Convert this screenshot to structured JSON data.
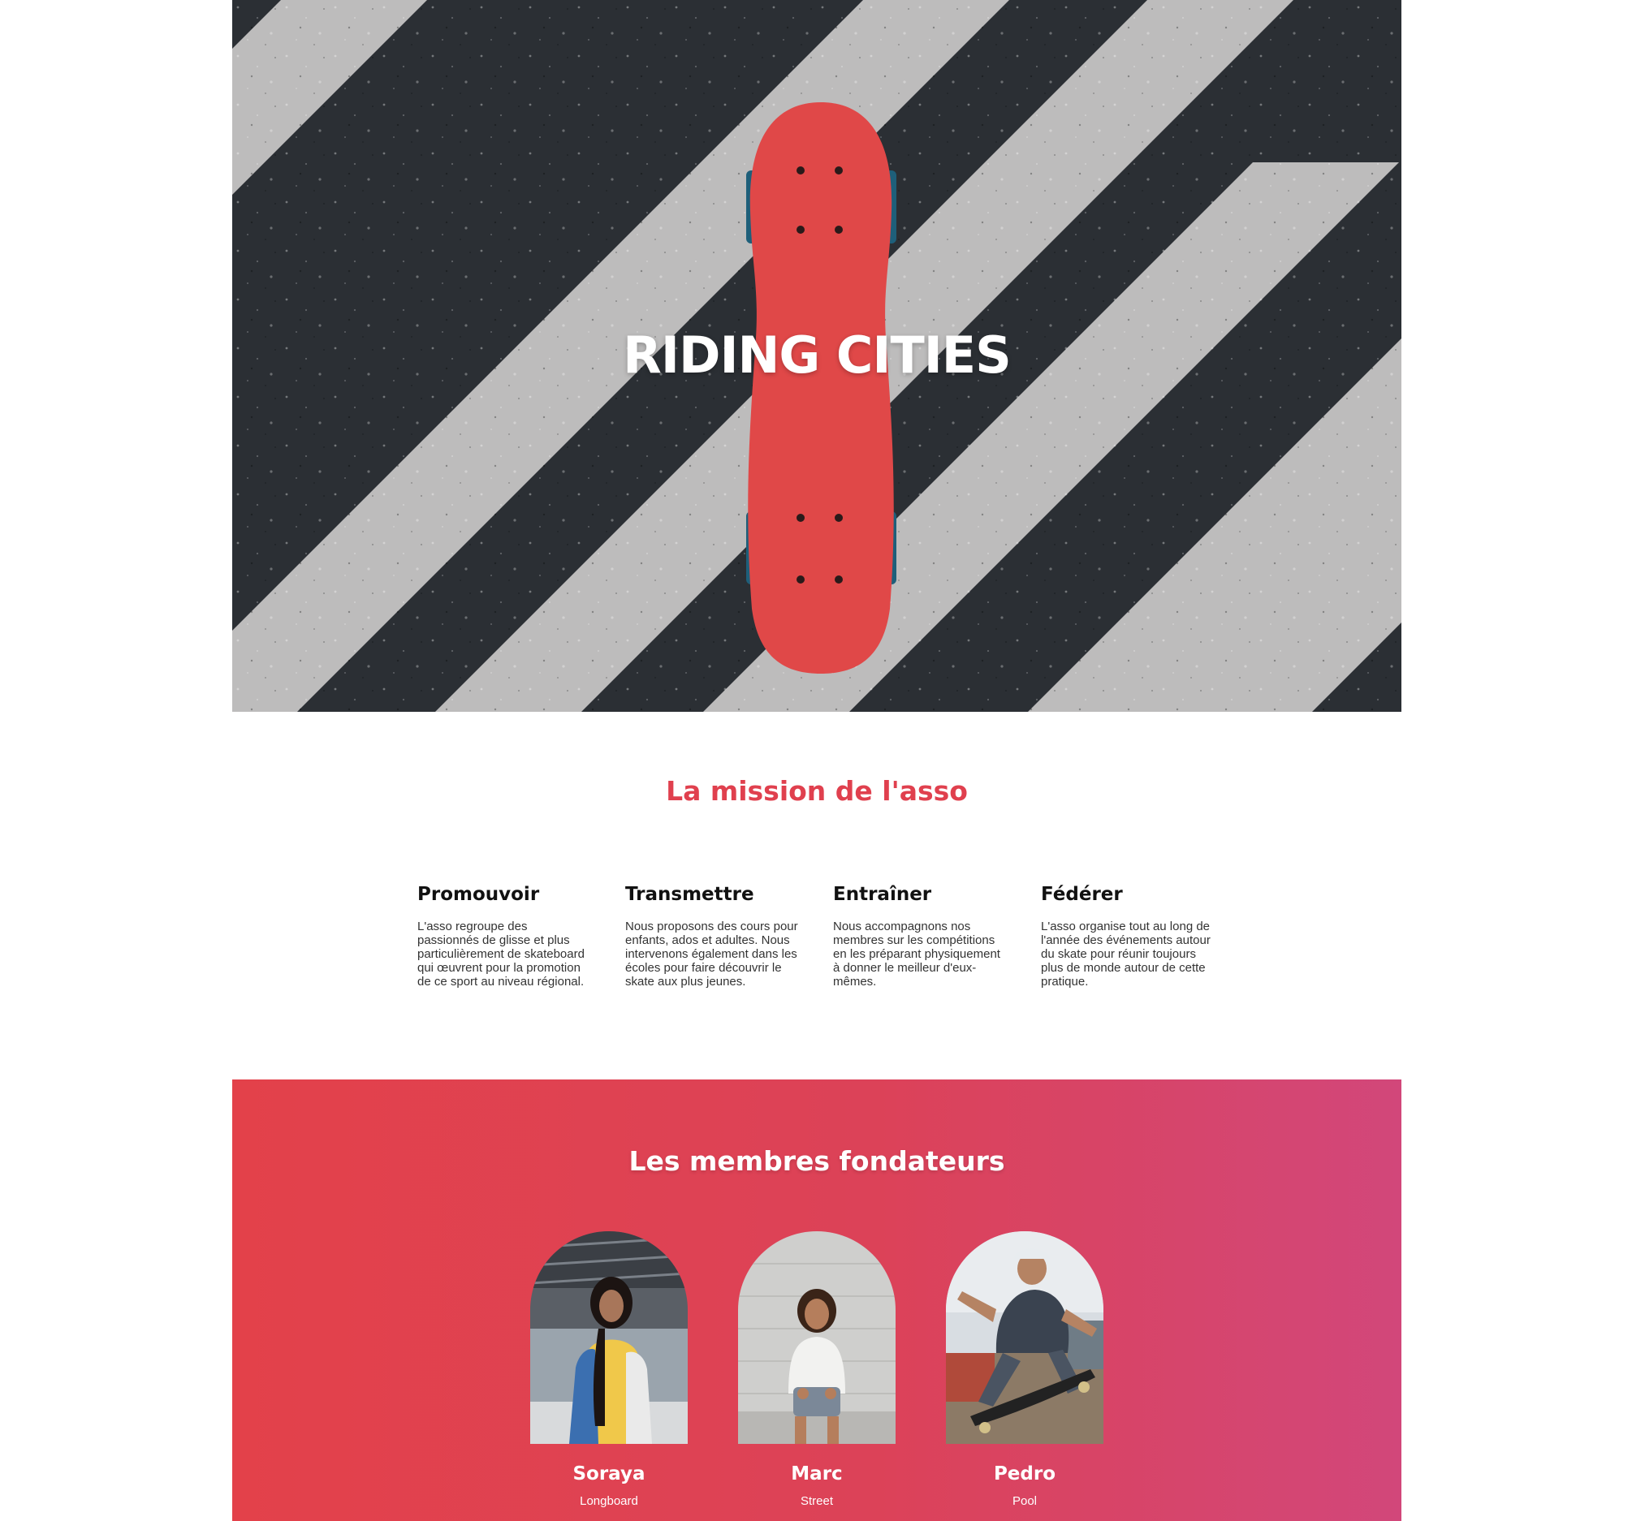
{
  "hero": {
    "title": "RIDING CITIES"
  },
  "mission": {
    "title": "La mission de l'asso",
    "items": [
      {
        "title": "Promouvoir",
        "text": "L'asso regroupe des passionnés de glisse et plus particulièrement de skateboard qui œuvrent pour la promotion de ce sport au niveau régional."
      },
      {
        "title": "Transmettre",
        "text": "Nous proposons des cours pour enfants, ados et adultes. Nous intervenons également dans les écoles pour faire découvrir le skate aux plus jeunes."
      },
      {
        "title": "Entraîner",
        "text": "Nous accompagnons nos membres sur les compétitions en les préparant physiquement à donner le meilleur d'eux-mêmes."
      },
      {
        "title": "Fédérer",
        "text": "L'asso organise tout au long de l'année des événements autour du skate pour réunir toujours plus de monde autour de cette pratique."
      }
    ]
  },
  "members": {
    "title": "Les membres fondateurs",
    "people": [
      {
        "name": "Soraya",
        "role": "Longboard"
      },
      {
        "name": "Marc",
        "role": "Street"
      },
      {
        "name": "Pedro",
        "role": "Pool"
      }
    ]
  },
  "colors": {
    "accent": "#e0404e",
    "gradient_start": "#e3414a",
    "gradient_end": "#d2477a",
    "skateboard": "#e04848",
    "asphalt": "#2b2f34",
    "stripe": "#bdbcbc"
  }
}
